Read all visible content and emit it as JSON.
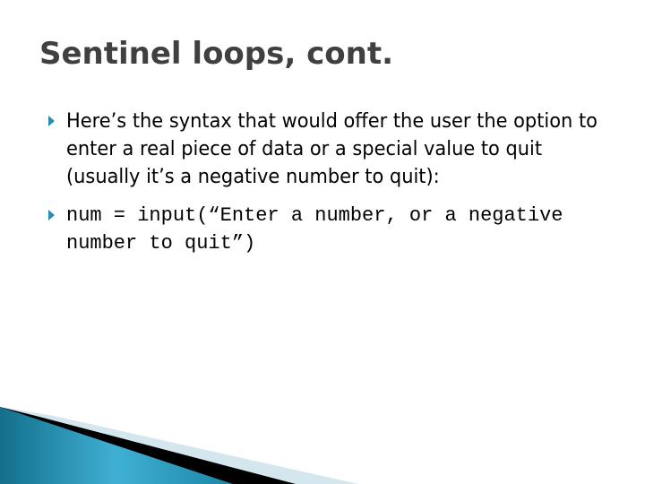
{
  "slide": {
    "title": "Sentinel loops, cont.",
    "bullets": [
      {
        "text": "Here’s the syntax that would offer the user the option to enter a real piece of data or a special value to quit (usually it’s a negative number to quit):",
        "style": "prose"
      },
      {
        "text": "num = input(“Enter a number, or a negative number to quit”)",
        "style": "code"
      }
    ],
    "bullet_icon": "triangle-right-icon",
    "colors": {
      "title": "#404040",
      "bullet": "#2a8cb0",
      "accent_teal": "#1f8aaa",
      "accent_black": "#000000",
      "accent_light": "#d4e6ee"
    }
  }
}
